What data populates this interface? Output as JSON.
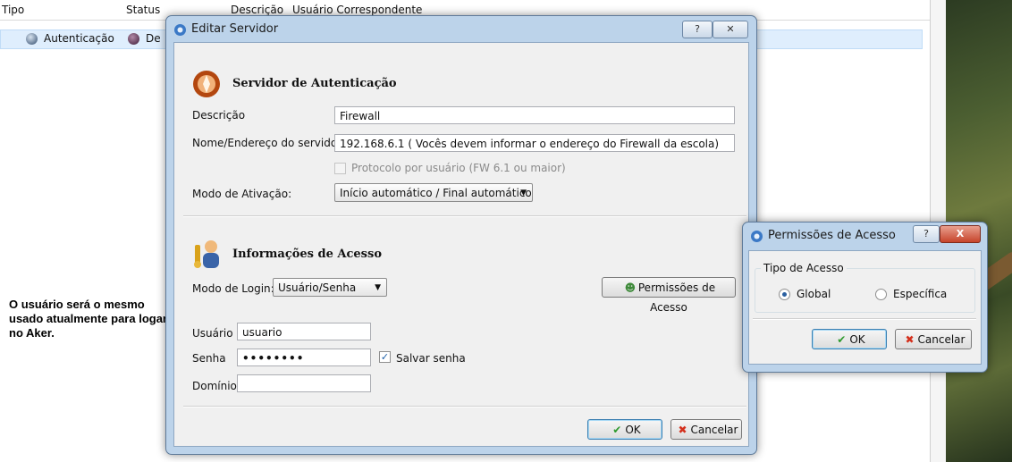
{
  "background_list": {
    "columns": [
      "Tipo",
      "Status",
      "Descrição",
      "Usuário Correspondente"
    ],
    "row": {
      "tipo": "Autenticação",
      "status": "De"
    }
  },
  "note": "O usuário será o mesmo usado atualmente para logar no Aker.",
  "edit_dialog": {
    "title": "Editar Servidor",
    "help_btn": "?",
    "close_btn": "✕",
    "auth_section_title": "Servidor de Autenticação",
    "descricao_label": "Descrição",
    "descricao_value": "Firewall",
    "nome_label": "Nome/Endereço do servidor",
    "nome_value": "192.168.6.1 ( Vocês devem informar o endereço do Firewall da escola)",
    "protocolo_label": "Protocolo por usuário (FW 6.1 ou maior)",
    "modo_ativacao_label": "Modo de Ativação:",
    "modo_ativacao_value": "Início automático / Final automático",
    "access_section_title": "Informações de Acesso",
    "modo_login_label": "Modo de Login:",
    "modo_login_value": "Usuário/Senha",
    "permissoes_btn": "Permissões de Acesso",
    "usuario_label": "Usuário",
    "usuario_value": "usuario",
    "senha_label": "Senha",
    "senha_value": "••••••••",
    "salvar_senha_label": "Salvar senha",
    "dominio_label": "Domínio",
    "dominio_value": "",
    "ok_btn": "OK",
    "cancel_btn": "Cancelar"
  },
  "perm_dialog": {
    "title": "Permissões de Acesso",
    "help_btn": "?",
    "close_btn": "X",
    "group_label": "Tipo de Acesso",
    "radio_global": "Global",
    "radio_especifica": "Específica",
    "ok_btn": "OK",
    "cancel_btn": "Cancelar"
  },
  "colors": {
    "ok_check": "#2e9a2e",
    "cancel_x": "#d4301c",
    "title_bar": "#bcd3ea"
  }
}
